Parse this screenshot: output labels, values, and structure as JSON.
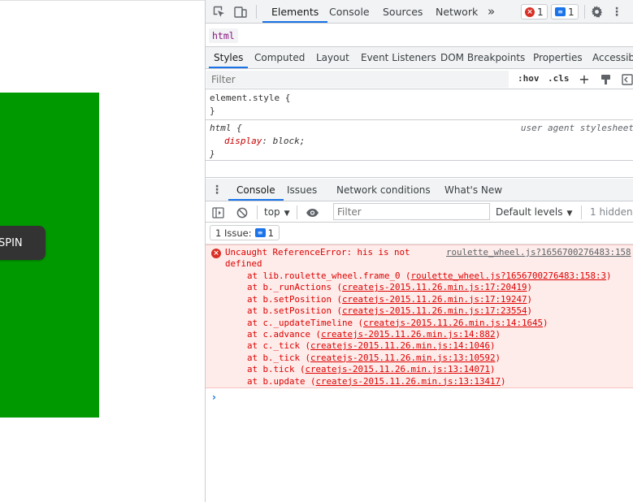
{
  "page": {
    "button_label": "SPIN"
  },
  "devtools": {
    "main_tabs": [
      "Elements",
      "Console",
      "Sources",
      "Network"
    ],
    "more_tabs_icon": "»",
    "error_count": "1",
    "message_count": "1",
    "breadcrumb": "html",
    "styles_tabs": [
      "Styles",
      "Computed",
      "Layout",
      "Event Listeners",
      "DOM Breakpoints",
      "Properties",
      "Accessibility"
    ],
    "styles_filter_placeholder": "Filter",
    "hov": ":hov",
    "cls": ".cls",
    "rules": {
      "element_style_selector": "element.style {",
      "close_brace": "}",
      "html_selector": "html {",
      "html_origin": "user agent stylesheet",
      "html_prop_name": "display",
      "html_prop_value": "block;"
    },
    "drawer_tabs": [
      "Console",
      "Issues",
      "Network conditions",
      "What's New"
    ],
    "console_toolbar": {
      "context": "top",
      "filter_placeholder": "Filter",
      "levels": "Default levels",
      "hidden": "1 hidden"
    },
    "issues": {
      "label": "1 Issue:",
      "count": "1"
    },
    "error": {
      "line1": "Uncaught ReferenceError: his is not",
      "line2": "defined",
      "source": "roulette_wheel.js?1656700276483:158",
      "stack": [
        {
          "prefix": "at lib.roulette_wheel.frame_0 (",
          "link": "roulette_wheel.js?1656700276483:158:3",
          "suffix": ")"
        },
        {
          "prefix": "at b._runActions (",
          "link": "createjs-2015.11.26.min.js:17:20419",
          "suffix": ")"
        },
        {
          "prefix": "at b.setPosition (",
          "link": "createjs-2015.11.26.min.js:17:19247",
          "suffix": ")"
        },
        {
          "prefix": "at b.setPosition (",
          "link": "createjs-2015.11.26.min.js:17:23554",
          "suffix": ")"
        },
        {
          "prefix": "at c._updateTimeline (",
          "link": "createjs-2015.11.26.min.js:14:1645",
          "suffix": ")"
        },
        {
          "prefix": "at c.advance (",
          "link": "createjs-2015.11.26.min.js:14:882",
          "suffix": ")"
        },
        {
          "prefix": "at c._tick (",
          "link": "createjs-2015.11.26.min.js:14:1046",
          "suffix": ")"
        },
        {
          "prefix": "at b._tick (",
          "link": "createjs-2015.11.26.min.js:13:10592",
          "suffix": ")"
        },
        {
          "prefix": "at b.tick (",
          "link": "createjs-2015.11.26.min.js:13:14071",
          "suffix": ")"
        },
        {
          "prefix": "at b.update (",
          "link": "createjs-2015.11.26.min.js:13:13417",
          "suffix": ")"
        }
      ]
    },
    "prompt": "›"
  },
  "colors": {
    "page_box": "#009900",
    "spin_button": "#333333",
    "accent": "#1a73e8",
    "error_bg": "#fdecea",
    "error_text": "#dd0000"
  }
}
